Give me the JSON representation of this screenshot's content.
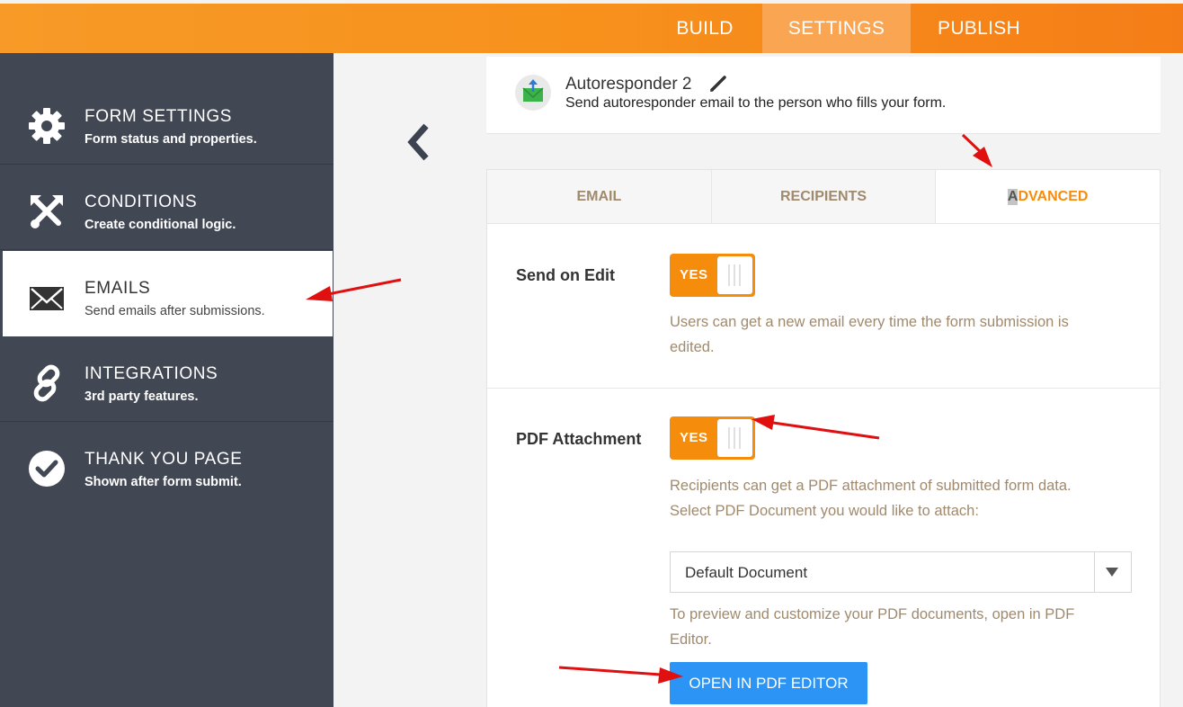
{
  "topnav": {
    "build": "BUILD",
    "settings": "SETTINGS",
    "publish": "PUBLISH",
    "active": "SETTINGS"
  },
  "sidebar": {
    "items": [
      {
        "title": "FORM SETTINGS",
        "subtitle": "Form status and properties.",
        "icon": "gear-icon"
      },
      {
        "title": "CONDITIONS",
        "subtitle": "Create conditional logic.",
        "icon": "conditions-icon"
      },
      {
        "title": "EMAILS",
        "subtitle": "Send emails after submissions.",
        "icon": "envelope-icon",
        "active": true
      },
      {
        "title": "INTEGRATIONS",
        "subtitle": "3rd party features.",
        "icon": "link-icon"
      },
      {
        "title": "THANK YOU PAGE",
        "subtitle": "Shown after form submit.",
        "icon": "check-circle-icon"
      }
    ]
  },
  "header": {
    "title": "Autoresponder 2",
    "description": "Send autoresponder email to the person who fills your form."
  },
  "tabs": {
    "email": "EMAIL",
    "recipients": "RECIPIENTS",
    "advanced_first": "A",
    "advanced_rest": "DVANCED",
    "active": "ADVANCED"
  },
  "send_on_edit": {
    "label": "Send on Edit",
    "toggle": "YES",
    "help": "Users can get a new email every time the form submission is edited."
  },
  "pdf_attachment": {
    "label": "PDF Attachment",
    "toggle": "YES",
    "help": "Recipients can get a PDF attachment of submitted form data. Select PDF Document you would like to attach:",
    "select_value": "Default Document",
    "preview_help": "To preview and customize your PDF documents, open in PDF Editor.",
    "button": "OPEN IN PDF EDITOR"
  },
  "colors": {
    "accent": "#f58c0b",
    "sidebar": "#424754",
    "button": "#2b94f5",
    "annotation": "#e01010"
  }
}
